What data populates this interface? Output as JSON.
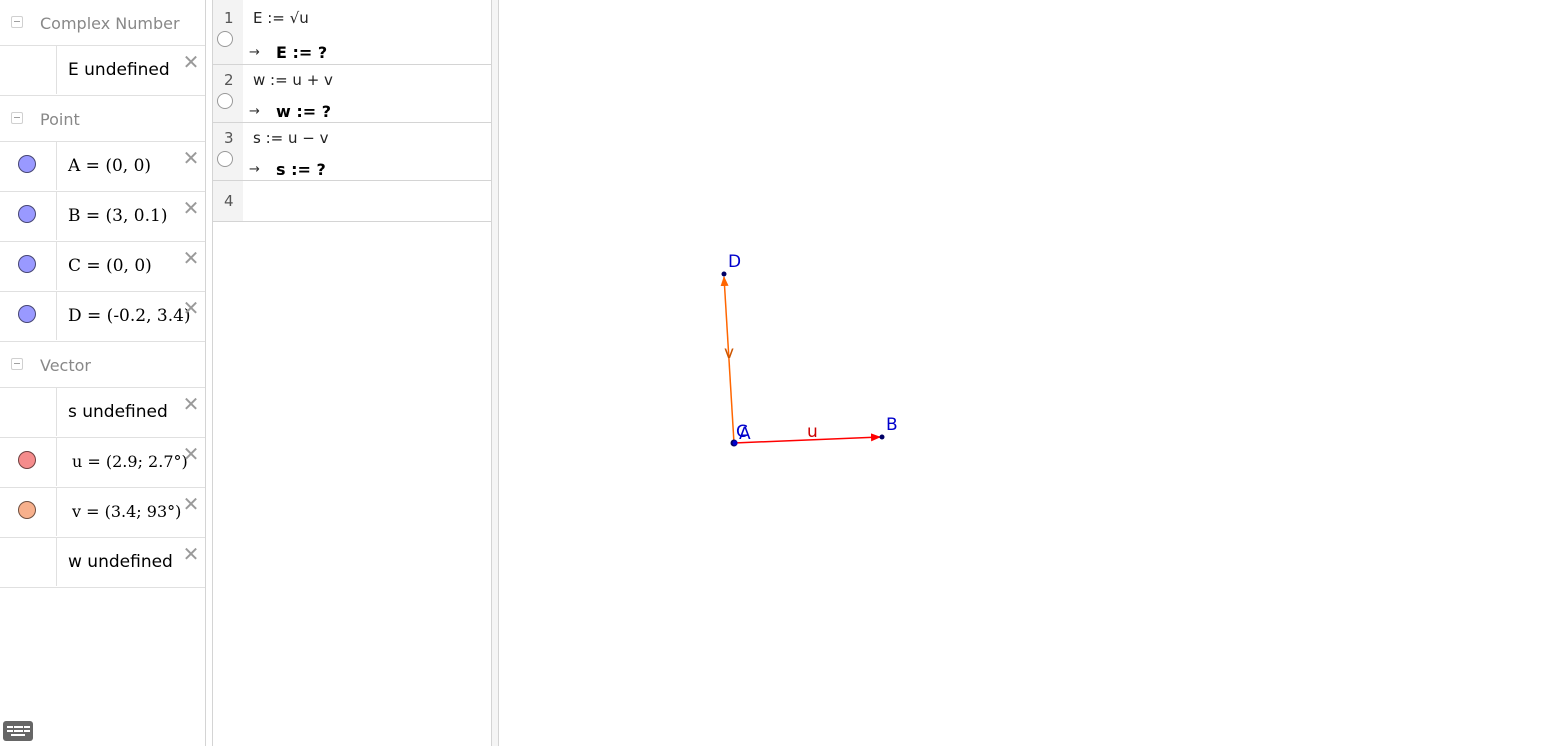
{
  "algebra": {
    "groups": [
      {
        "label": "Complex Number",
        "items": [
          {
            "text": "E undefined",
            "marble": null
          }
        ]
      },
      {
        "label": "Point",
        "items": [
          {
            "text": "A = (0, 0)",
            "marble": "#9999ff"
          },
          {
            "text": "B = (3, 0.1)",
            "marble": "#9999ff"
          },
          {
            "text": "C = (0, 0)",
            "marble": "#9999ff"
          },
          {
            "text": "D = (-0.2, 3.4)",
            "marble": "#9999ff"
          }
        ]
      },
      {
        "label": "Vector",
        "items": [
          {
            "text": "s undefined",
            "marble": null
          },
          {
            "text": "u = (2.9; 2.7°)",
            "marble": "#f58c8c"
          },
          {
            "text": "v = (3.4; 93°)",
            "marble": "#f7b08c"
          },
          {
            "text": "w undefined",
            "marble": null
          }
        ]
      }
    ],
    "delete_glyph": "✕"
  },
  "cas": {
    "rows": [
      {
        "num": "1",
        "input": "E := √u",
        "output": "E := ?"
      },
      {
        "num": "2",
        "input": "w := u + v",
        "output": "w := ?"
      },
      {
        "num": "3",
        "input": "s := u − v",
        "output": "s := ?"
      },
      {
        "num": "4",
        "input": "",
        "output": ""
      }
    ],
    "arrow": "→"
  },
  "graphics": {
    "points": [
      {
        "name": "A",
        "label": "A",
        "color": "#0000cc"
      },
      {
        "name": "B",
        "label": "B",
        "color": "#0000cc"
      },
      {
        "name": "C",
        "label": "C",
        "color": "#0000cc"
      },
      {
        "name": "D",
        "label": "D",
        "color": "#0000cc"
      }
    ],
    "vectors": [
      {
        "name": "u",
        "label": "u",
        "from": "A",
        "to": "B",
        "color": "#ff0000",
        "label_color": "#cc0000"
      },
      {
        "name": "v",
        "label": "v",
        "from": "C",
        "to": "D",
        "color": "#ff6600",
        "label_color": "#cc5500"
      }
    ]
  },
  "icons": {
    "keyboard": "keyboard-icon"
  }
}
